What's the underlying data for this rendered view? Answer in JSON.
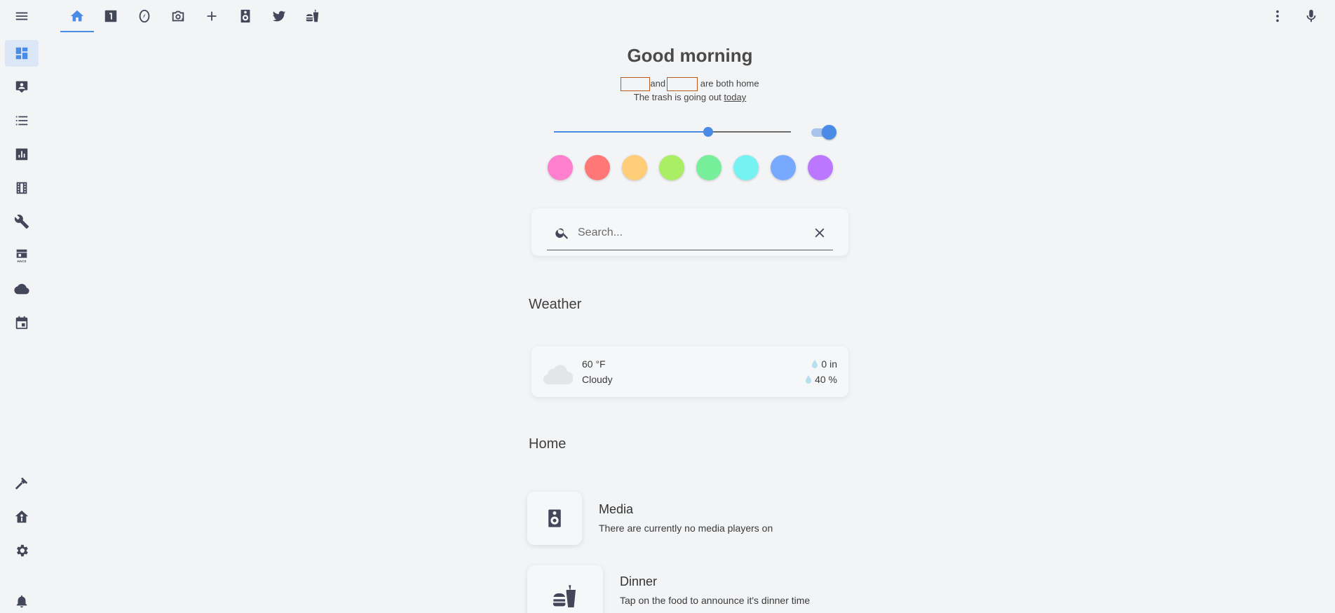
{
  "sidebar": {
    "items": [
      {
        "icon": "menu-icon"
      },
      {
        "icon": "dashboard-icon"
      },
      {
        "icon": "account-card-icon"
      },
      {
        "icon": "list-icon"
      },
      {
        "icon": "chart-icon"
      },
      {
        "icon": "film-icon"
      },
      {
        "icon": "wrench-icon"
      },
      {
        "icon": "hacs-store-icon",
        "label": "HACS"
      },
      {
        "icon": "cloud-icon"
      },
      {
        "icon": "calendar-icon"
      },
      {
        "icon": "hammer-icon"
      },
      {
        "icon": "home-assistant-icon"
      },
      {
        "icon": "gear-icon"
      },
      {
        "icon": "bell-icon"
      }
    ]
  },
  "tabs": [
    {
      "icon": "home-icon",
      "active": true
    },
    {
      "icon": "numeric-1-box-icon"
    },
    {
      "icon": "compass-icon"
    },
    {
      "icon": "camera-switch-icon"
    },
    {
      "icon": "plus-icon"
    },
    {
      "icon": "speaker-icon"
    },
    {
      "icon": "twitter-icon"
    },
    {
      "icon": "food-icon"
    }
  ],
  "header_right": [
    {
      "icon": "more-vertical-icon"
    },
    {
      "icon": "microphone-icon"
    }
  ],
  "greeting": "Good morning",
  "presence": {
    "connector": "and",
    "suffix": "are both home"
  },
  "trash": {
    "prefix": "The trash is going out",
    "link": "today"
  },
  "brightness": {
    "value": 0.65
  },
  "light_toggle": {
    "on": true
  },
  "color_swatches": [
    "#ff7fcf",
    "#ff7777",
    "#ffcc77",
    "#aaee66",
    "#77ee99",
    "#77f2f2",
    "#77aaff",
    "#bb77ff"
  ],
  "search": {
    "placeholder": "Search..."
  },
  "weather": {
    "title": "Weather",
    "temperature": "60 °F",
    "condition": "Cloudy",
    "precipitation": "0 in",
    "precip_probability": "40 %"
  },
  "home": {
    "title": "Home",
    "media": {
      "title": "Media",
      "subtitle": "There are currently no media players on"
    },
    "dinner": {
      "title": "Dinner",
      "subtitle": "Tap on the food to announce it's dinner time"
    }
  },
  "colors": {
    "accent": "#4a8be6",
    "background": "#f3f4f6",
    "icon": "#44475a"
  }
}
